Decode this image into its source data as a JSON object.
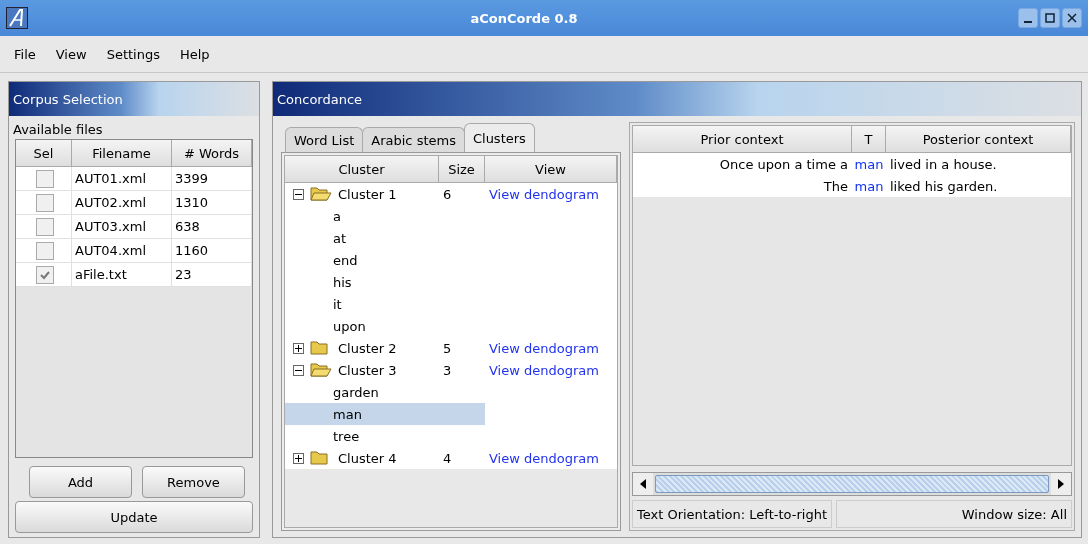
{
  "window": {
    "title": "aConCorde 0.8"
  },
  "menu": [
    "File",
    "View",
    "Settings",
    "Help"
  ],
  "corpus": {
    "title": "Corpus Selection",
    "label": "Available files",
    "columns": [
      "Sel",
      "Filename",
      "# Words"
    ],
    "rows": [
      {
        "checked": false,
        "filename": "AUT01.xml",
        "words": "3399"
      },
      {
        "checked": false,
        "filename": "AUT02.xml",
        "words": "1310"
      },
      {
        "checked": false,
        "filename": "AUT03.xml",
        "words": "638"
      },
      {
        "checked": false,
        "filename": "AUT04.xml",
        "words": "1160"
      },
      {
        "checked": true,
        "filename": "aFile.txt",
        "words": "23"
      }
    ],
    "buttons": [
      "Add",
      "Remove"
    ],
    "update": "Update"
  },
  "concordance": {
    "title": "Concordance",
    "tabs": [
      {
        "label": "Word List",
        "selected": false
      },
      {
        "label": "Arabic stems",
        "selected": false
      },
      {
        "label": "Clusters",
        "selected": true
      }
    ],
    "tree": {
      "columns": [
        "Cluster",
        "Size",
        "View"
      ],
      "items": [
        {
          "label": "Cluster 1",
          "size": "6",
          "link": "View dendogram",
          "expanded": true,
          "children": [
            {
              "label": "a",
              "selected": false
            },
            {
              "label": "at",
              "selected": false
            },
            {
              "label": "end",
              "selected": false
            },
            {
              "label": "his",
              "selected": false
            },
            {
              "label": "it",
              "selected": false
            },
            {
              "label": "upon",
              "selected": false
            }
          ]
        },
        {
          "label": "Cluster 2",
          "size": "5",
          "link": "View dendogram",
          "expanded": false
        },
        {
          "label": "Cluster 3",
          "size": "3",
          "link": "View dendogram",
          "expanded": true,
          "children": [
            {
              "label": "garden",
              "selected": false
            },
            {
              "label": "man",
              "selected": true
            },
            {
              "label": "tree",
              "selected": false
            }
          ]
        },
        {
          "label": "Cluster 4",
          "size": "4",
          "link": "View dendogram",
          "expanded": false
        }
      ]
    },
    "table": {
      "columns": [
        "Prior context",
        "T",
        "Posterior context"
      ],
      "rows": [
        {
          "prior": "Once upon a time a",
          "target": "man",
          "posterior": "lived in a house."
        },
        {
          "prior": "The",
          "target": "man",
          "posterior": "liked his garden."
        }
      ]
    },
    "status": [
      "Text Orientation: Left-to-right",
      "Window size: All"
    ]
  }
}
